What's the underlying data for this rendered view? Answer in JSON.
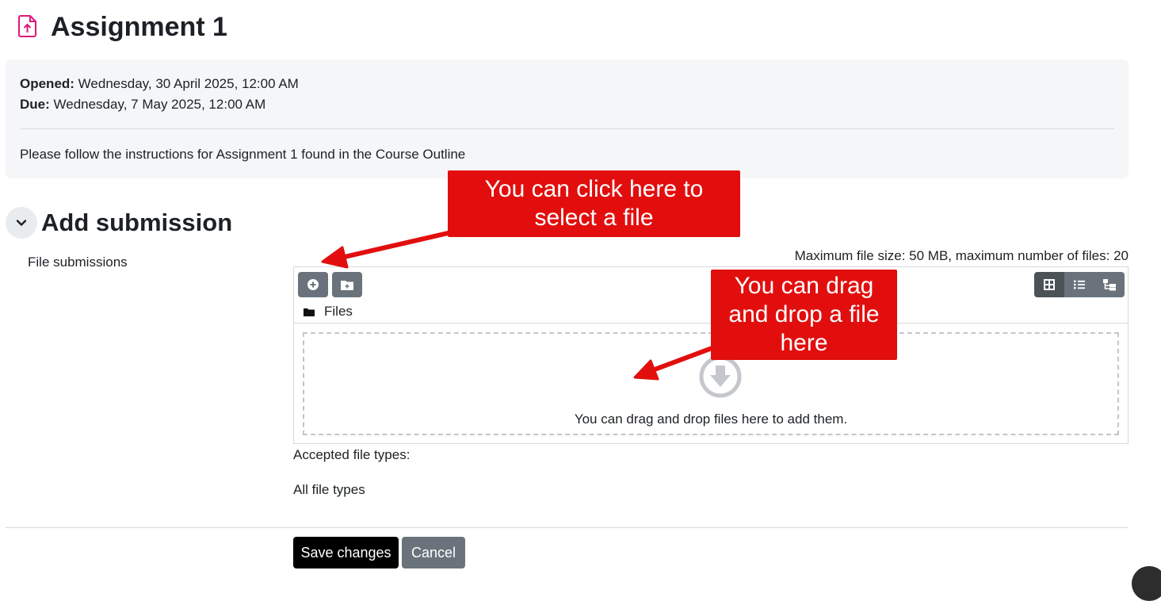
{
  "page": {
    "title": "Assignment 1",
    "icon": "assignment-upload-icon",
    "accent_color": "#e0157c"
  },
  "dates": {
    "opened_label": "Opened:",
    "opened_value": " Wednesday, 30 April 2025, 12:00 AM",
    "due_label": "Due:",
    "due_value": " Wednesday, 7 May 2025, 12:00 AM"
  },
  "description": "Please follow the instructions for Assignment 1 found in the Course Outline",
  "section": {
    "title": "Add submission",
    "collapse_icon": "chevron-down-icon"
  },
  "form": {
    "field_label": "File submissions",
    "max_info": "Maximum file size: 50 MB, maximum number of files: 20",
    "path_label": "Files",
    "dropzone_text": "You can drag and drop files here to add them.",
    "accepted_label": "Accepted file types:",
    "accepted_value": "All file types"
  },
  "filepicker": {
    "toolbar_icons": [
      "add-file-icon",
      "create-folder-icon"
    ],
    "view_icons": [
      "grid-view-icon",
      "list-view-icon",
      "tree-view-icon"
    ],
    "button_color": "#6a737b"
  },
  "actions": {
    "save_label": "Save changes",
    "cancel_label": "Cancel"
  },
  "annotations": {
    "select_line1": "You can click here to",
    "select_line2": "select a file",
    "drag_line1": "You can drag",
    "drag_line2": "and drop a file",
    "drag_line3": "here",
    "color": "#e20e0e"
  }
}
